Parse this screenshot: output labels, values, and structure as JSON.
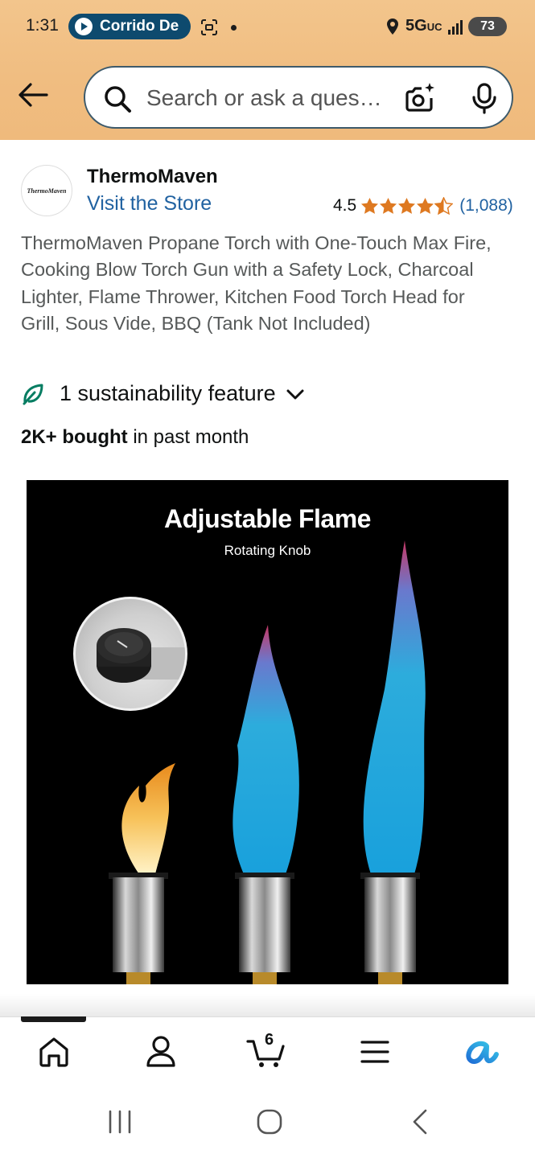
{
  "status_bar": {
    "time": "1:31",
    "media_label": "Corrido De",
    "network": "5G",
    "network_sub": "UC",
    "battery": "73"
  },
  "search": {
    "placeholder": "Search or ask a question"
  },
  "product": {
    "brand_name": "ThermoMaven",
    "logo_text": "ThermoMaven",
    "visit_store": "Visit the Store",
    "rating_value": "4.5",
    "rating": 4.5,
    "rating_count": "(1,088)",
    "title": "ThermoMaven Propane Torch with One-Touch Max Fire, Cooking Blow Torch Gun with a Safety Lock, Charcoal Lighter, Flame Thrower, Kitchen Food Torch Head for Grill, Sous Vide, BBQ (Tank Not Included)",
    "sustainability": "1 sustainability feature",
    "bought_bold": "2K+ bought",
    "bought_rest": " in past month",
    "image": {
      "headline": "Adjustable Flame",
      "subline": "Rotating Knob"
    }
  },
  "bottom_nav": {
    "cart_count": "6",
    "items": [
      "home-icon",
      "account-icon",
      "cart-icon",
      "menu-icon",
      "rufus-icon"
    ]
  },
  "colors": {
    "header_bg": "#f0bd81",
    "link": "#2162a1",
    "star": "#de7921",
    "leaf": "#067d62"
  }
}
